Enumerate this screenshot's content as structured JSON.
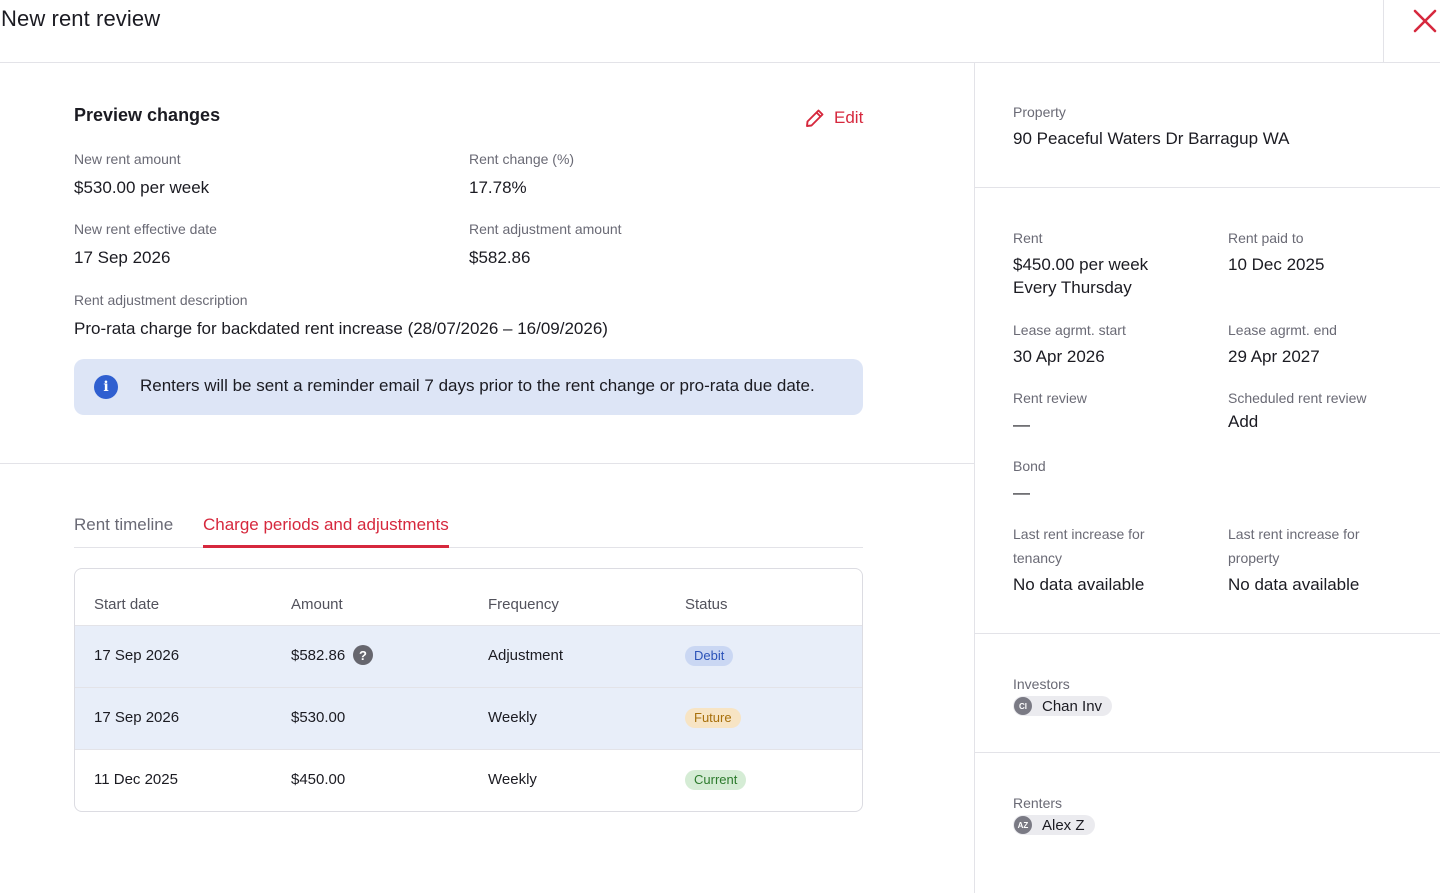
{
  "header": {
    "title": "New rent review",
    "close_icon": "close-icon",
    "accent_color": "#d6283d"
  },
  "preview": {
    "title": "Preview changes",
    "edit_label": "Edit",
    "new_rent_amount_label": "New rent amount",
    "new_rent_amount_value": "$530.00 per week",
    "rent_change_label": "Rent change (%)",
    "rent_change_value": "17.78%",
    "effective_date_label": "New rent effective date",
    "effective_date_value": "17 Sep 2026",
    "adjustment_amount_label": "Rent adjustment amount",
    "adjustment_amount_value": "$582.86",
    "adjustment_desc_label": "Rent adjustment description",
    "adjustment_desc_value": "Pro-rata charge for backdated rent increase (28/07/2026 – 16/09/2026)",
    "info_icon": "i",
    "info_text": "Renters will be sent a reminder email 7 days prior to the rent change or pro-rata due date."
  },
  "tabs": [
    {
      "label": "Rent timeline",
      "active": false
    },
    {
      "label": "Charge periods and adjustments",
      "active": true
    }
  ],
  "table": {
    "headers": [
      "Start date",
      "Amount",
      "Frequency",
      "Status"
    ],
    "rows": [
      {
        "start_date": "17 Sep 2026",
        "amount": "$582.86",
        "help_icon": "?",
        "frequency": "Adjustment",
        "status": "Debit"
      },
      {
        "start_date": "17 Sep 2026",
        "amount": "$530.00",
        "frequency": "Weekly",
        "status": "Future"
      },
      {
        "start_date": "11 Dec 2025",
        "amount": "$450.00",
        "frequency": "Weekly",
        "status": "Current"
      }
    ]
  },
  "sidebar": {
    "property_label": "Property",
    "property_value": "90 Peaceful Waters Dr Barragup WA",
    "rent_label": "Rent",
    "rent_value_line1": "$450.00 per week",
    "rent_value_line2": "Every Thursday",
    "rent_paid_to_label": "Rent paid to",
    "rent_paid_to_value": "10 Dec 2025",
    "lease_start_label": "Lease agrmt. start",
    "lease_start_value": "30 Apr 2026",
    "lease_end_label": "Lease agrmt. end",
    "lease_end_value": "29 Apr 2027",
    "rent_review_label": "Rent review",
    "rent_review_value": "—",
    "scheduled_review_label": "Scheduled rent review",
    "scheduled_review_value": "Add",
    "bond_label": "Bond",
    "bond_value": "—",
    "last_increase_tenancy_label_1": "Last rent increase for",
    "last_increase_tenancy_label_2": "tenancy",
    "last_increase_tenancy_value": "No data available",
    "last_increase_property_label_1": "Last rent increase for",
    "last_increase_property_label_2": "property",
    "last_increase_property_value": "No data available",
    "investors_label": "Investors",
    "investor_initials": "CI",
    "investor_name": "Chan Inv",
    "renters_label": "Renters",
    "renter_initials": "AZ",
    "renter_name": "Alex Z"
  }
}
